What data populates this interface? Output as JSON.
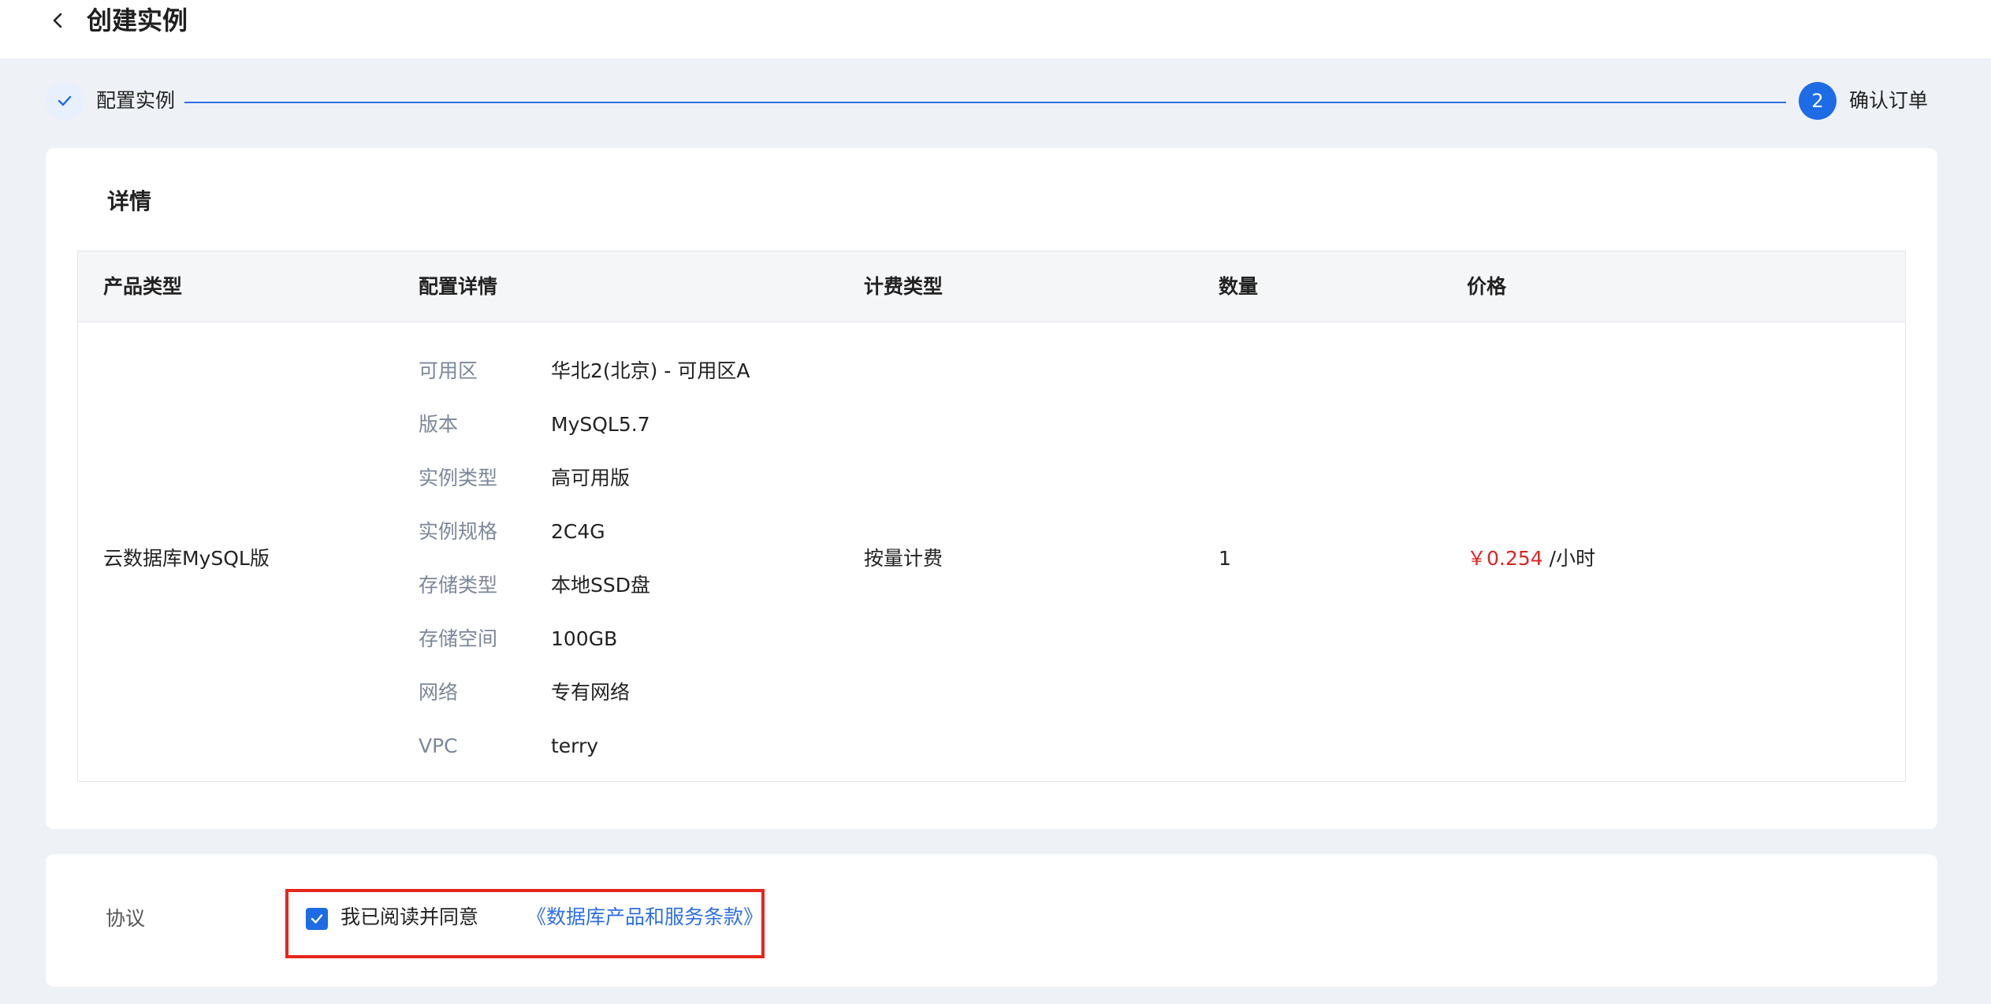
{
  "header": {
    "title": "创建实例",
    "back_icon": "chevron-left-icon"
  },
  "steps": [
    {
      "label": "配置实例",
      "status": "done",
      "icon": "check-icon"
    },
    {
      "label": "确认订单",
      "status": "active",
      "number": "2"
    }
  ],
  "details": {
    "title": "详情",
    "columns": [
      "产品类型",
      "配置详情",
      "计费类型",
      "数量",
      "价格"
    ],
    "row": {
      "product_type": "云数据库MySQL版",
      "config": [
        {
          "key": "可用区",
          "value": "华北2(北京) - 可用区A"
        },
        {
          "key": "版本",
          "value": "MySQL5.7"
        },
        {
          "key": "实例类型",
          "value": "高可用版"
        },
        {
          "key": "实例规格",
          "value": "2C4G"
        },
        {
          "key": "存储类型",
          "value": "本地SSD盘"
        },
        {
          "key": "存储空间",
          "value": "100GB"
        },
        {
          "key": "网络",
          "value": "专有网络"
        },
        {
          "key": "VPC",
          "value": "terry"
        }
      ],
      "billing_type": "按量计费",
      "quantity": "1",
      "price_amount": "￥0.254",
      "price_unit": " /小时"
    }
  },
  "agreement": {
    "label": "协议",
    "checked": true,
    "text": "我已阅读并同意",
    "link_text": "《数据库产品和服务条款》"
  },
  "colors": {
    "primary": "#1e6be6",
    "price": "#e02424",
    "highlight_border": "#e5261b",
    "page_bg": "#eef1f6"
  }
}
